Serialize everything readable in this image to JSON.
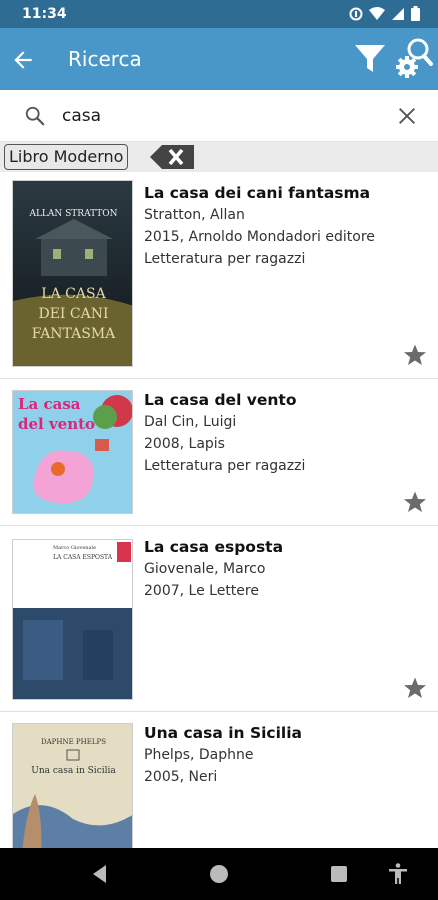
{
  "status_bar": {
    "time": "11:34",
    "icons": [
      "data-saver-icon",
      "wifi-icon",
      "signal-icon",
      "battery-icon"
    ]
  },
  "app_bar": {
    "title": "Ricerca",
    "icons": [
      "arrow-back-icon",
      "filter-icon",
      "search-settings-icon"
    ]
  },
  "search": {
    "value": "casa",
    "icons": [
      "search-icon",
      "clear-icon"
    ]
  },
  "filter_chip": {
    "label": "Libro Moderno"
  },
  "results": [
    {
      "title": "La casa dei cani fantasma",
      "author": "Stratton, Allan",
      "publication": "2015, Arnoldo Mondadori editore",
      "category": "Letteratura per ragazzi",
      "cover_texts": [
        "ALLAN STRATTON",
        "LA CASA",
        "DEI CANI",
        "FANTASMA"
      ]
    },
    {
      "title": "La casa del vento",
      "author": "Dal Cin, Luigi",
      "publication": "2008, Lapis",
      "category": "Letteratura per ragazzi",
      "cover_texts": [
        "La casa",
        "del vento"
      ]
    },
    {
      "title": "La casa esposta",
      "author": "Giovenale, Marco",
      "publication": "2007, Le Lettere",
      "category": "",
      "cover_texts": [
        "Marco Giovenale",
        "LA CASA ESPOSTA"
      ]
    },
    {
      "title": "Una casa in Sicilia",
      "author": "Phelps, Daphne",
      "publication": "2005, Neri",
      "category": "",
      "cover_texts": [
        "DAPHNE PHELPS",
        "Una casa in Sicilia"
      ]
    }
  ],
  "nav_bar": {
    "icons": [
      "back-triangle-icon",
      "home-circle-icon",
      "recents-square-icon",
      "accessibility-icon"
    ]
  },
  "colors": {
    "status_bar": "#2e6c94",
    "app_bar": "#4897c8",
    "star": "#6b6b6b"
  }
}
